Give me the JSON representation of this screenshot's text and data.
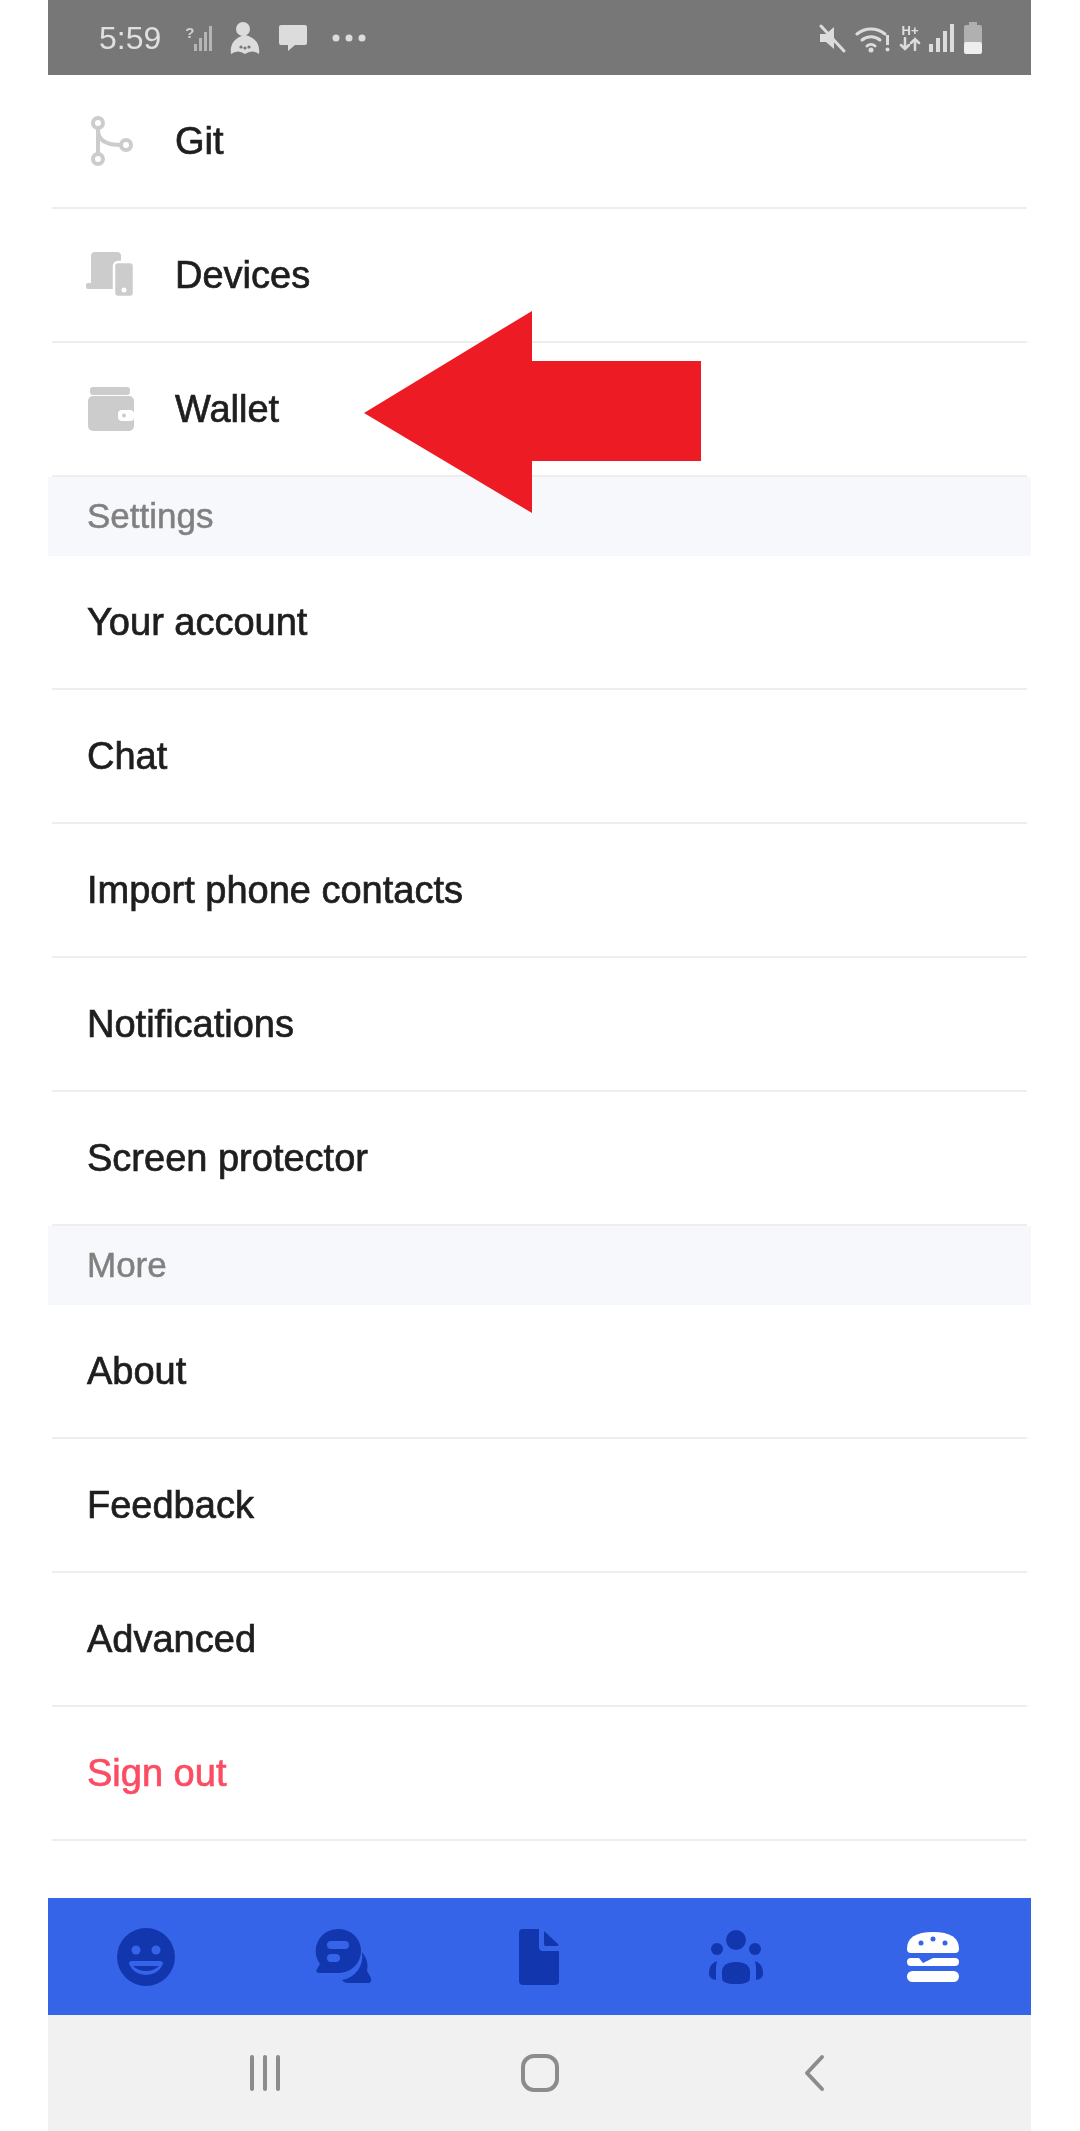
{
  "status_bar": {
    "time": "5:59",
    "left_icons": [
      {
        "kind": "no-sim",
        "mark": "?"
      },
      {
        "kind": "character"
      },
      {
        "kind": "message"
      },
      {
        "kind": "more"
      }
    ],
    "right_icons": [
      {
        "kind": "mute"
      },
      {
        "kind": "wifi"
      },
      {
        "kind": "data",
        "label": "H+"
      },
      {
        "kind": "signal"
      },
      {
        "kind": "battery"
      }
    ]
  },
  "sections": [
    {
      "items": [
        {
          "kind": "git",
          "label": "Git"
        },
        {
          "kind": "devices",
          "label": "Devices"
        },
        {
          "kind": "wallet",
          "label": "Wallet"
        }
      ]
    },
    {
      "header": "Settings",
      "items": [
        {
          "kind": "link",
          "label": "Your account"
        },
        {
          "kind": "link",
          "label": "Chat"
        },
        {
          "kind": "link",
          "label": "Import phone contacts"
        },
        {
          "kind": "link",
          "label": "Notifications"
        },
        {
          "kind": "link",
          "label": "Screen protector"
        }
      ]
    },
    {
      "header": "More",
      "items": [
        {
          "kind": "link",
          "label": "About"
        },
        {
          "kind": "link",
          "label": "Feedback"
        },
        {
          "kind": "link",
          "label": "Advanced"
        },
        {
          "kind": "danger",
          "label": "Sign out"
        }
      ]
    }
  ],
  "bottom_nav": [
    {
      "kind": "smiley",
      "selected": false
    },
    {
      "kind": "chat",
      "selected": false
    },
    {
      "kind": "document",
      "selected": false
    },
    {
      "kind": "people",
      "selected": false
    },
    {
      "kind": "burger",
      "selected": true
    }
  ],
  "system_nav": [
    {
      "kind": "recents"
    },
    {
      "kind": "home"
    },
    {
      "kind": "back"
    }
  ],
  "annotations": [
    {
      "kind": "arrow"
    }
  ]
}
